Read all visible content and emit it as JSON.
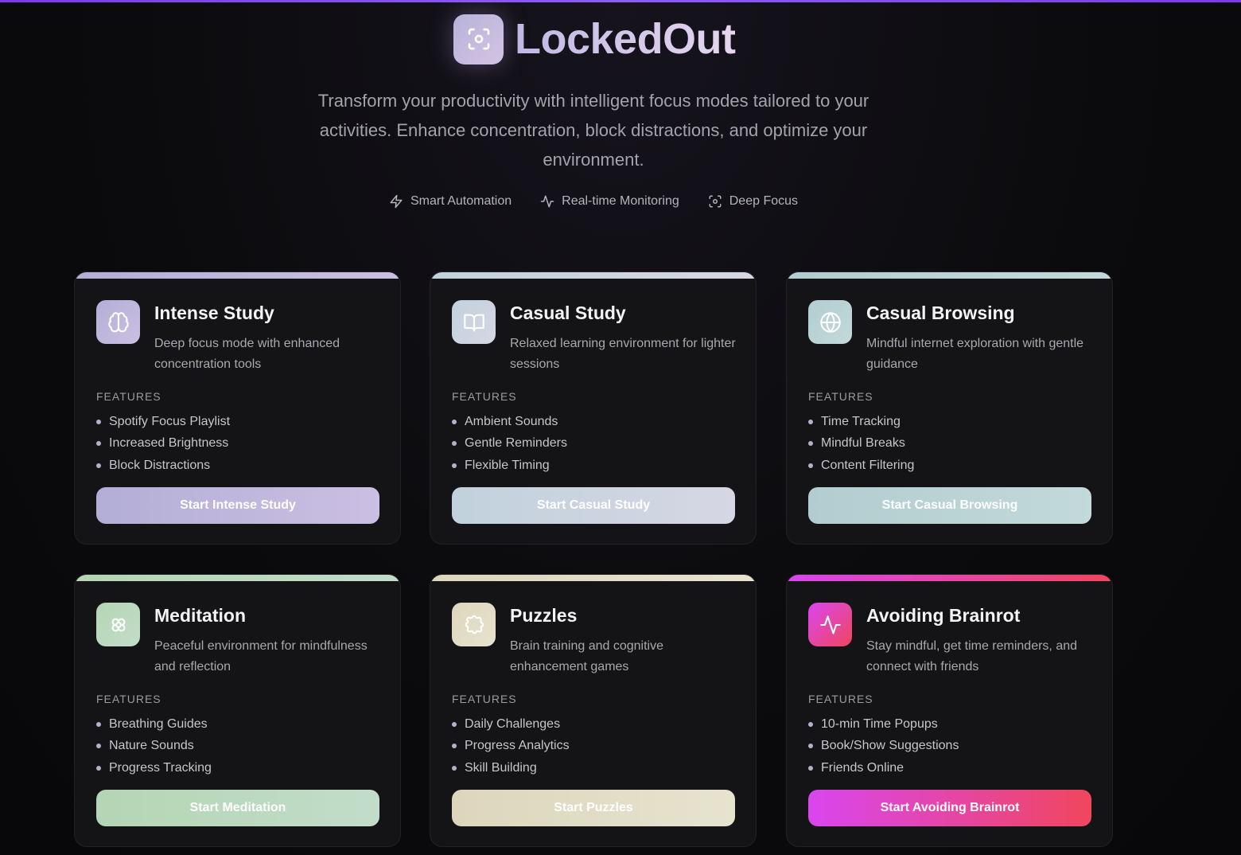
{
  "app": {
    "name": "LockedOut",
    "subtitle": "Transform your productivity with intelligent focus modes tailored to your activities. Enhance concentration, block distractions, and optimize your environment.",
    "accent": "#7c3aed"
  },
  "chips": [
    {
      "label": "Smart Automation",
      "icon": "lightning-icon"
    },
    {
      "label": "Real-time Monitoring",
      "icon": "activity-icon"
    },
    {
      "label": "Deep Focus",
      "icon": "focus-icon"
    }
  ],
  "features_label": "FEATURES",
  "modes": [
    {
      "title": "Intense Study",
      "description": "Deep focus mode with enhanced concentration tools",
      "features": [
        "Spotify Focus Playlist",
        "Increased Brightness",
        "Block Distractions"
      ],
      "button": "Start Intense Study",
      "icon": "brain-icon",
      "colors": [
        "#b3aed6",
        "#cbbfe2"
      ]
    },
    {
      "title": "Casual Study",
      "description": "Relaxed learning environment for lighter sessions",
      "features": [
        "Ambient Sounds",
        "Gentle Reminders",
        "Flexible Timing"
      ],
      "button": "Start Casual Study",
      "icon": "book-icon",
      "colors": [
        "#c1d2dc",
        "#d6d6e4"
      ]
    },
    {
      "title": "Casual Browsing",
      "description": "Mindful internet exploration with gentle guidance",
      "features": [
        "Time Tracking",
        "Mindful Breaks",
        "Content Filtering"
      ],
      "button": "Start Casual Browsing",
      "icon": "globe-icon",
      "colors": [
        "#b2cdd0",
        "#c3d9da"
      ]
    },
    {
      "title": "Meditation",
      "description": "Peaceful environment for mindfulness and reflection",
      "features": [
        "Breathing Guides",
        "Nature Sounds",
        "Progress Tracking"
      ],
      "button": "Start Meditation",
      "icon": "flower-icon",
      "colors": [
        "#b4d6b4",
        "#c2dcc9"
      ]
    },
    {
      "title": "Puzzles",
      "description": "Brain training and cognitive enhancement games",
      "features": [
        "Daily Challenges",
        "Progress Analytics",
        "Skill Building"
      ],
      "button": "Start Puzzles",
      "icon": "puzzle-icon",
      "colors": [
        "#ddd6bc",
        "#e6e3cf"
      ]
    },
    {
      "title": "Avoiding Brainrot",
      "description": "Stay mindful, get time reminders, and connect with friends",
      "features": [
        "10-min Time Popups",
        "Book/Show Suggestions",
        "Friends Online"
      ],
      "button": "Start Avoiding Brainrot",
      "icon": "pulse-icon",
      "colors": [
        "#d946ef",
        "#f0465e"
      ]
    }
  ]
}
